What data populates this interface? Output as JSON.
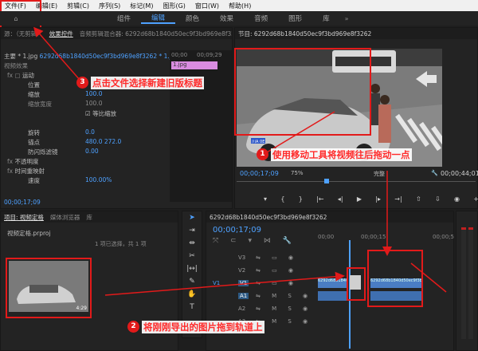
{
  "menu": [
    "文件(F)",
    "编辑(E)",
    "剪辑(C)",
    "序列(S)",
    "标记(M)",
    "图形(G)",
    "窗口(W)",
    "帮助(H)"
  ],
  "workspaces": [
    "组件",
    "编辑",
    "颜色",
    "效果",
    "音频",
    "图形",
    "库"
  ],
  "workspace_active": "编辑",
  "source_panel": {
    "tabs": [
      "源：（无剪辑）",
      "效果控件",
      "音频剪辑混合器: 6292d68b1840d50ec9f3bd969e8f3262"
    ],
    "master_label": "主要 * 1.jpg",
    "clip_path": "6292d68b1840d50ec9f3bd969e8f3262 * 1.jpg",
    "mini_time_start": "00;00",
    "mini_time_end": "00;09;29",
    "clip_name": "1.jpg",
    "section": "视频效果",
    "motion": "运动",
    "props": [
      {
        "label": "位置",
        "value": ""
      },
      {
        "label": "缩放",
        "value": "100.0"
      },
      {
        "label": "缩放宽度",
        "value": "100.0"
      },
      {
        "label": "等比缩放",
        "value": ""
      },
      {
        "label": "旋转",
        "value": "0.0"
      },
      {
        "label": "锚点",
        "value": "480.0    272.0"
      },
      {
        "label": "防闪烁滤镜",
        "value": "0.00"
      }
    ],
    "opacity": "不透明度",
    "timeremap": "时间重映射",
    "speed_label": "速度",
    "speed_value": "100.00%",
    "timecode": "00;00;17;09"
  },
  "program": {
    "title": "节目: 6292d68b1840d50ec9f3bd969e8f3262",
    "timecode": "00;00;17;09",
    "zoom": "75%",
    "quality": "完整",
    "duration": "00;00;44;01",
    "plate": "川A 0E"
  },
  "project": {
    "tabs": [
      "项目: 视频定格",
      "媒体浏览器",
      "库"
    ],
    "file": "视频定格.prproj",
    "search_hint": "1 项已选择，共 1 项",
    "thumb_duration": "4:29"
  },
  "timeline": {
    "title": "6292d68b1840d50ec9f3bd969e8f3262",
    "timecode": "00;00;17;09",
    "ruler": [
      "00;00",
      "00;00;15",
      "00;00;5"
    ],
    "tracks_video": [
      "V3",
      "V2",
      "V1"
    ],
    "tracks_audio": [
      "A1",
      "A2",
      "A3"
    ],
    "clip_label": "6292d68b1840d50ec9f3bd969e8f3262"
  },
  "annotations": [
    {
      "num": "1",
      "text": "使用移动工具将视频往后拖动一点"
    },
    {
      "num": "2",
      "text": "将刚刚导出的图片拖到轨道上"
    },
    {
      "num": "3",
      "text": "点击文件选择新建旧版标题"
    }
  ]
}
